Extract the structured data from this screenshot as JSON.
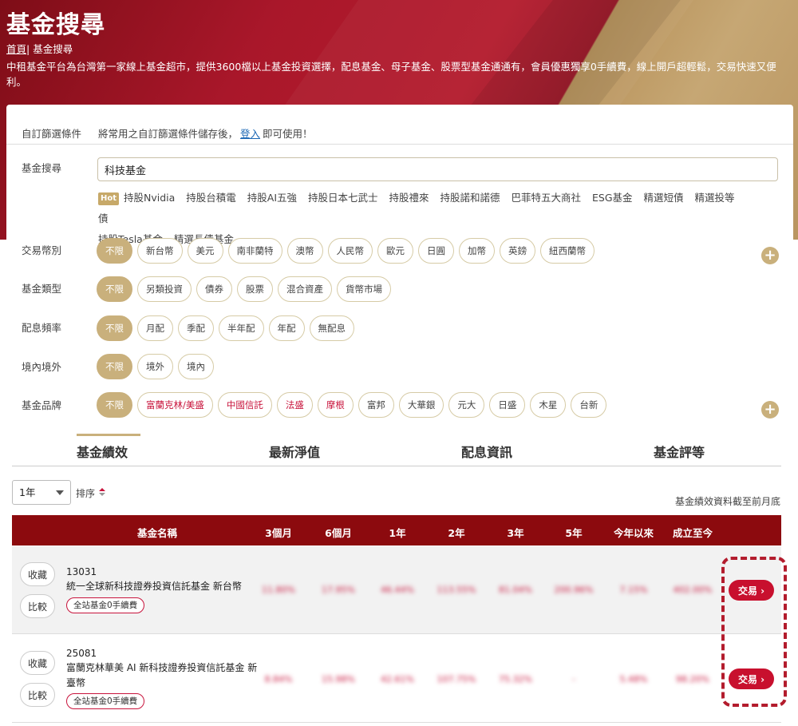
{
  "header": {
    "title": "基金搜尋",
    "breadcrumb_home": "首頁",
    "breadcrumb_sep": "|",
    "breadcrumb_current": "基金搜尋",
    "intro": "中租基金平台為台灣第一家線上基金超市，提供3600檔以上基金投資選擇，配息基金、母子基金、股票型基金通通有，會員優惠獨享0手續費，線上開戶超輕鬆，交易快速又便利。"
  },
  "filters": {
    "saved_label": "自訂篩選條件",
    "saved_prefix": "將常用之自訂篩選條件儲存後，",
    "saved_login": "登入",
    "saved_suffix": "即可使用！",
    "search_label": "基金搜尋",
    "search_value": "科技基金",
    "hot_badge": "Hot",
    "hot_tags": [
      "持股Nvidia",
      "持股台積電",
      "持股AI五強",
      "持股日本七武士",
      "持股禮來",
      "持股諾和諾德",
      "巴菲特五大商社",
      "ESG基金",
      "精選短債",
      "精選投等債",
      "持股Tesla基金",
      "精選長債基金"
    ],
    "currency_label": "交易幣別",
    "currency": [
      "不限",
      "新台幣",
      "美元",
      "南非蘭特",
      "澳幣",
      "人民幣",
      "歐元",
      "日圓",
      "加幣",
      "英鎊",
      "紐西蘭幣"
    ],
    "type_label": "基金類型",
    "type": [
      "不限",
      "另類投資",
      "債券",
      "股票",
      "混合資產",
      "貨幣市場"
    ],
    "dividend_label": "配息頻率",
    "dividend": [
      "不限",
      "月配",
      "季配",
      "半年配",
      "年配",
      "無配息"
    ],
    "domestic_label": "境內境外",
    "domestic": [
      "不限",
      "境外",
      "境內"
    ],
    "brand_label": "基金品牌",
    "brand": [
      "不限",
      "富蘭克林/美盛",
      "中國信託",
      "法盛",
      "摩根",
      "富邦",
      "大華銀",
      "元大",
      "日盛",
      "木星",
      "台新"
    ],
    "plus": "+"
  },
  "tabs": [
    "基金績效",
    "最新淨值",
    "配息資訊",
    "基金評等"
  ],
  "controls": {
    "period": "1年",
    "sort_label": "排序",
    "data_note": "基金績效資料截至前月底"
  },
  "table": {
    "headers": [
      "基金名稱",
      "3個月",
      "6個月",
      "1年",
      "2年",
      "3年",
      "5年",
      "今年以來",
      "成立至今"
    ],
    "collect_label": "收藏",
    "compare_label": "比較",
    "trade_label": "交易 ›",
    "rows": [
      {
        "code": "13031",
        "name": "統一全球新科技證券投資信託基金 新台幣",
        "badge": "全站基金0手續費",
        "perf": [
          "11.80%",
          "17.95%",
          "46.44%",
          "113.55%",
          "81.04%",
          "200.96%",
          "7.15%",
          "402.00%"
        ]
      },
      {
        "code": "25081",
        "name": "富蘭克林華美 AI 新科技證券投資信託基金 新臺幣",
        "badge": "全站基金0手續費",
        "perf": [
          "8.84%",
          "15.98%",
          "42.61%",
          "107.75%",
          "75.32%",
          "-",
          "5.48%",
          "98.20%"
        ]
      }
    ]
  }
}
